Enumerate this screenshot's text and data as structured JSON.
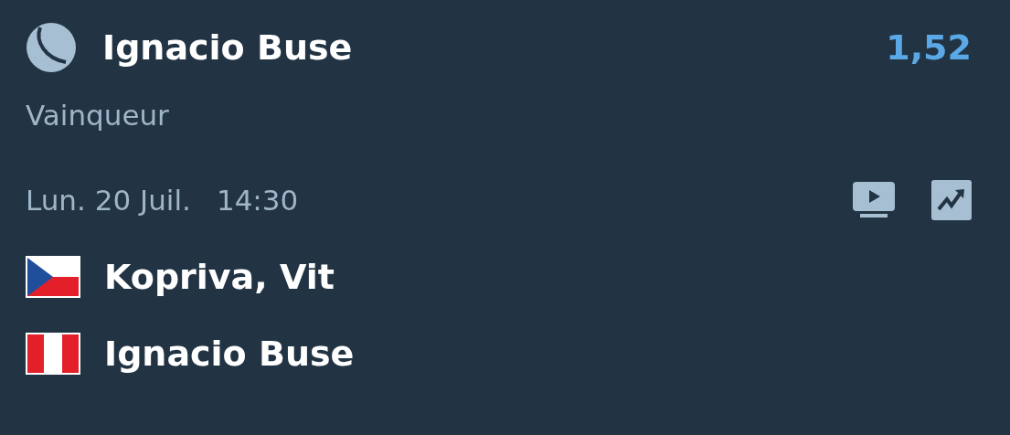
{
  "selection": {
    "name": "Ignacio Buse",
    "odds": "1,52",
    "market": "Vainqueur"
  },
  "match": {
    "date": "Lun. 20 Juil.",
    "time": "14:30"
  },
  "players": [
    {
      "name": "Kopriva, Vit",
      "kind": "czech"
    },
    {
      "name": "Ignacio Buse",
      "kind": "peru"
    }
  ]
}
